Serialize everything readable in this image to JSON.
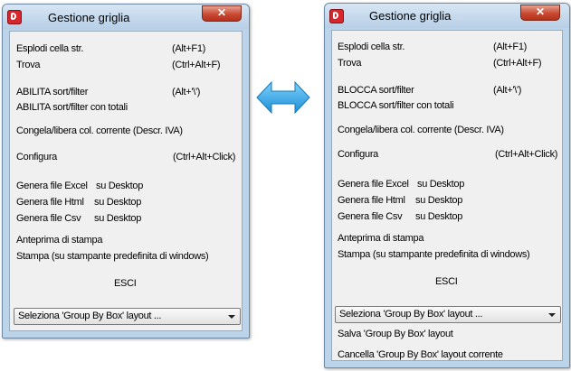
{
  "left_window": {
    "title": "Gestione griglia",
    "close_glyph": "✕",
    "items": {
      "esplodi": "Esplodi cella str.",
      "esplodi_sc": "(Alt+F1)",
      "trova": "Trova",
      "trova_sc": "(Ctrl+Alt+F)",
      "sort": "ABILITA sort/filter",
      "sort_sc": "(Alt+'\\')",
      "sort_totali": "ABILITA sort/filter con totali",
      "congela": "Congela/libera col. corrente (Descr. IVA)",
      "configura": "Configura",
      "configura_sc": "(Ctrl+Alt+Click)",
      "excel": "Genera file Excel",
      "excel_dest": "su Desktop",
      "html": "Genera file Html",
      "html_dest": "su Desktop",
      "csv": "Genera file Csv",
      "csv_dest": "su Desktop",
      "anteprima": "Anteprima di stampa",
      "stampa": "Stampa (su stampante predefinita di windows)",
      "esci": "ESCI"
    },
    "combo": "Seleziona 'Group By Box' layout ..."
  },
  "right_window": {
    "title": "Gestione griglia",
    "close_glyph": "✕",
    "items": {
      "esplodi": "Esplodi cella str.",
      "esplodi_sc": "(Alt+F1)",
      "trova": "Trova",
      "trova_sc": "(Ctrl+Alt+F)",
      "sort": "BLOCCA sort/filter",
      "sort_sc": "(Alt+'\\')",
      "sort_totali": "BLOCCA sort/filter con totali",
      "congela": "Congela/libera col. corrente (Descr. IVA)",
      "configura": "Configura",
      "configura_sc": "(Ctrl+Alt+Click)",
      "excel": "Genera file Excel",
      "excel_dest": "su Desktop",
      "html": "Genera file Html",
      "html_dest": "su Desktop",
      "csv": "Genera file Csv",
      "csv_dest": "su Desktop",
      "anteprima": "Anteprima di stampa",
      "stampa": "Stampa (su stampante predefinita di windows)",
      "esci": "ESCI"
    },
    "combo": "Seleziona 'Group By Box' layout ...",
    "salva": "Salva 'Group By Box' layout",
    "cancella": "Cancella 'Group By Box' layout corrente"
  },
  "colors": {
    "window_frame": "#bcd4ea",
    "client_bg": "#f0f0f0",
    "close_button": "#c94a32",
    "arrow": "#1e9be0"
  },
  "icons": {
    "app": "app-logo-icon",
    "close": "close-icon",
    "dropdown": "chevron-down-icon",
    "transition": "double-arrow-icon"
  }
}
